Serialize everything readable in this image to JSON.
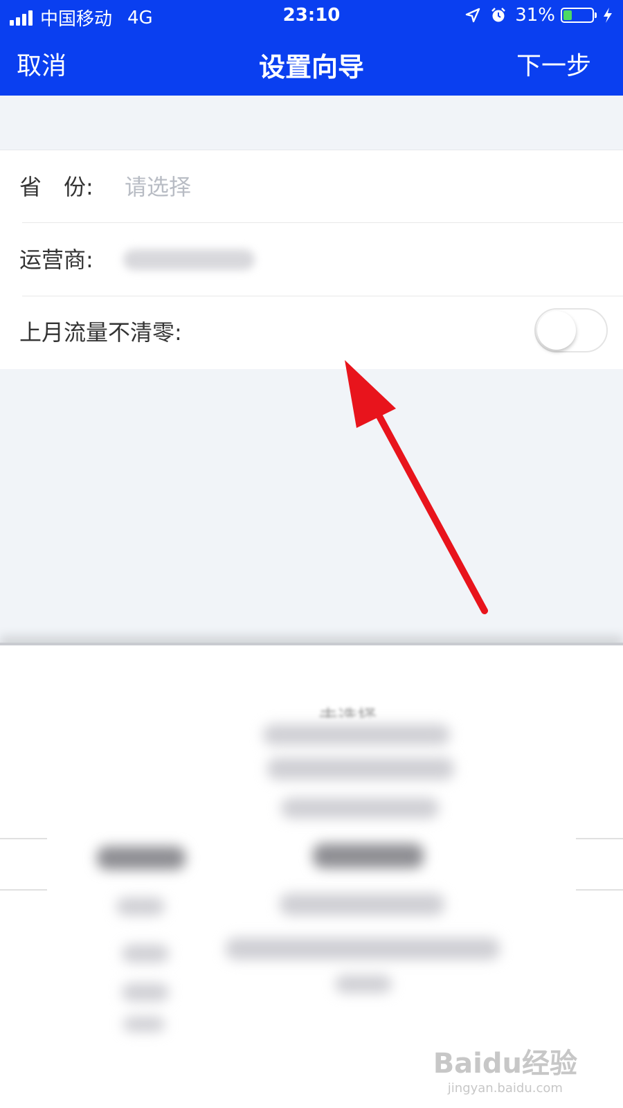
{
  "status_bar": {
    "carrier": "中国移动",
    "network": "4G",
    "time": "23:10",
    "battery_percent": "31%",
    "battery_level": 0.31,
    "battery_color": "#4cd964",
    "icons": [
      "signal-icon",
      "location-icon",
      "alarm-icon",
      "battery-icon",
      "charging-icon"
    ]
  },
  "nav": {
    "cancel_label": "取消",
    "title": "设置向导",
    "next_label": "下一步",
    "background_color": "#0a3ff0"
  },
  "form": {
    "province_label": "省　份:",
    "province_placeholder": "请选择",
    "carrier_label": "运营商:",
    "carry_over_label": "上月流量不清零:",
    "carry_over_enabled": false
  },
  "picker": {
    "unselected_label": "未选择"
  },
  "annotation_arrow_color": "#e8141c",
  "watermark": {
    "logo_text": "Baidu经验",
    "url_text": "jingyan.baidu.com"
  }
}
